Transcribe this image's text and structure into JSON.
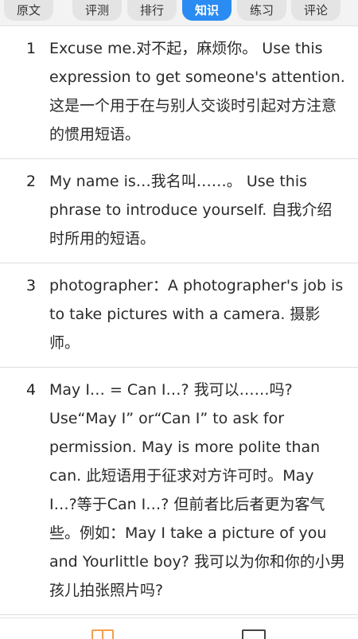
{
  "tabs": [
    {
      "label": "原文"
    },
    {
      "label": "评测"
    },
    {
      "label": "排行"
    },
    {
      "label": "知识"
    },
    {
      "label": "练习"
    },
    {
      "label": "评论"
    }
  ],
  "active_tab": "知识",
  "items": [
    {
      "num": "1",
      "text": "Excuse me.对不起，麻烦你。 Use this expression to get someone's attention. 这是一个用于在与别人交谈时引起对方注意的惯用短语。"
    },
    {
      "num": "2",
      "text": "My name is…我名叫……。 Use this phrase to introduce yourself. 自我介绍时所用的短语。"
    },
    {
      "num": "3",
      "text": "photographer：A photographer's job is to take pictures with a camera. 摄影师。"
    },
    {
      "num": "4",
      "text": "May I… = Can I…? 我可以……吗? Use“May I” or“Can I” to ask for permission. May is more polite than can. 此短语用于征求对方许可时。May I…?等于Can I…? 但前者比后者更为客气些。例如：May I take a picture of you and Yourlittle boy? 我可以为你和你的小男孩儿拍张照片吗?"
    }
  ],
  "bottom_bar": {
    "left_icon": "book-icon",
    "right_icon": "square-icon",
    "accent_color": "#f2a04a"
  }
}
